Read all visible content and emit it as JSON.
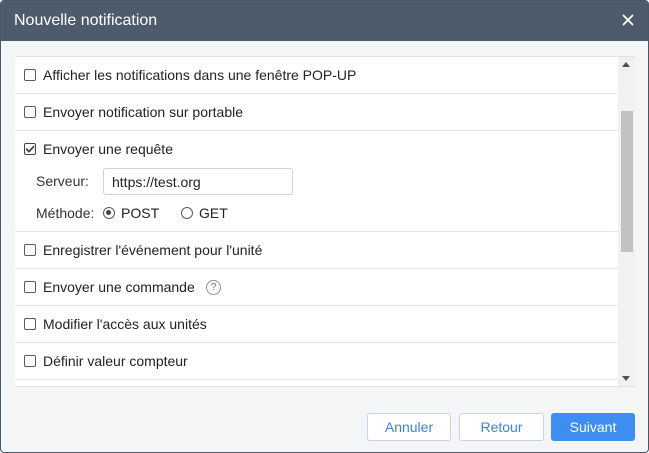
{
  "dialog": {
    "title": "Nouvelle notification",
    "close_icon": "close-icon"
  },
  "actions": [
    {
      "label": "Afficher les notifications dans une fenêtre POP-UP",
      "checked": false
    },
    {
      "label": "Envoyer notification sur portable",
      "checked": false
    },
    {
      "label": "Envoyer une requête",
      "checked": true
    },
    {
      "label": "Enregistrer l'événement pour l'unité",
      "checked": false
    },
    {
      "label": "Envoyer une commande",
      "checked": false,
      "help_icon": "question-circle-icon"
    },
    {
      "label": "Modifier l'accès aux unités",
      "checked": false
    },
    {
      "label": "Définir valeur compteur",
      "checked": false
    }
  ],
  "request": {
    "server_label": "Serveur:",
    "server_value": "https://test.org",
    "method_label": "Méthode:",
    "methods": [
      {
        "label": "POST",
        "selected": true
      },
      {
        "label": "GET",
        "selected": false
      }
    ]
  },
  "buttons": {
    "cancel": "Annuler",
    "back": "Retour",
    "next": "Suivant"
  },
  "colors": {
    "titlebar": "#4e5b6c",
    "primary": "#3d8ef0",
    "link": "#3b82e0"
  }
}
